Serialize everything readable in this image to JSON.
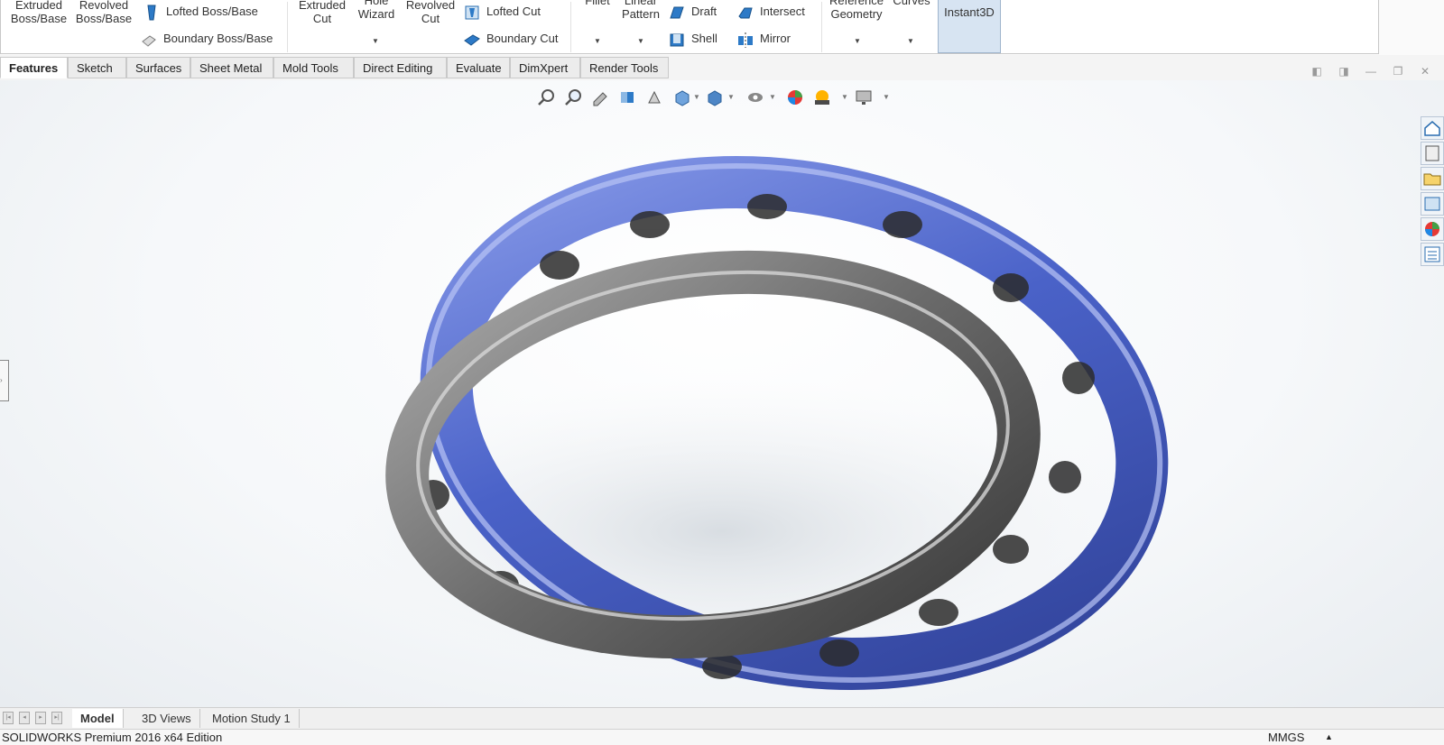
{
  "ribbon": {
    "features": [
      {
        "id": "extruded-boss",
        "label1": "Extruded",
        "label2": "Boss/Base"
      },
      {
        "id": "revolved-boss",
        "label1": "Revolved",
        "label2": "Boss/Base"
      },
      {
        "id": "extruded-cut",
        "label1": "Extruded",
        "label2": "Cut"
      },
      {
        "id": "hole-wizard",
        "label1": "Hole",
        "label2": "Wizard"
      },
      {
        "id": "revolved-cut",
        "label1": "Revolved",
        "label2": "Cut"
      },
      {
        "id": "fillet",
        "label1": "Fillet",
        "label2": ""
      },
      {
        "id": "linear-pattern",
        "label1": "Linear",
        "label2": "Pattern"
      },
      {
        "id": "reference-geometry",
        "label1": "Reference",
        "label2": "Geometry"
      },
      {
        "id": "curves",
        "label1": "Curves",
        "label2": ""
      }
    ],
    "small": {
      "lofted_boss": "Lofted Boss/Base",
      "boundary_boss": "Boundary Boss/Base",
      "lofted_cut": "Lofted Cut",
      "boundary_cut": "Boundary Cut",
      "draft": "Draft",
      "shell": "Shell",
      "intersect": "Intersect",
      "mirror": "Mirror"
    },
    "instant3d": "Instant3D"
  },
  "tabs": [
    "Features",
    "Sketch",
    "Surfaces",
    "Sheet Metal",
    "Mold Tools",
    "Direct Editing",
    "Evaluate",
    "DimXpert",
    "Render Tools"
  ],
  "active_tab": "Features",
  "bottom_tabs": [
    "Model",
    "3D Views",
    "Motion Study 1"
  ],
  "active_bottom_tab": "Model",
  "status": {
    "edition": "SOLIDWORKS Premium 2016 x64 Edition",
    "units": "MMGS",
    "units_caret": "▲"
  },
  "colors": {
    "accent": "#1e6fb5",
    "ring_blue": "#4a62c8",
    "ring_gray": "#6e6e6e"
  }
}
